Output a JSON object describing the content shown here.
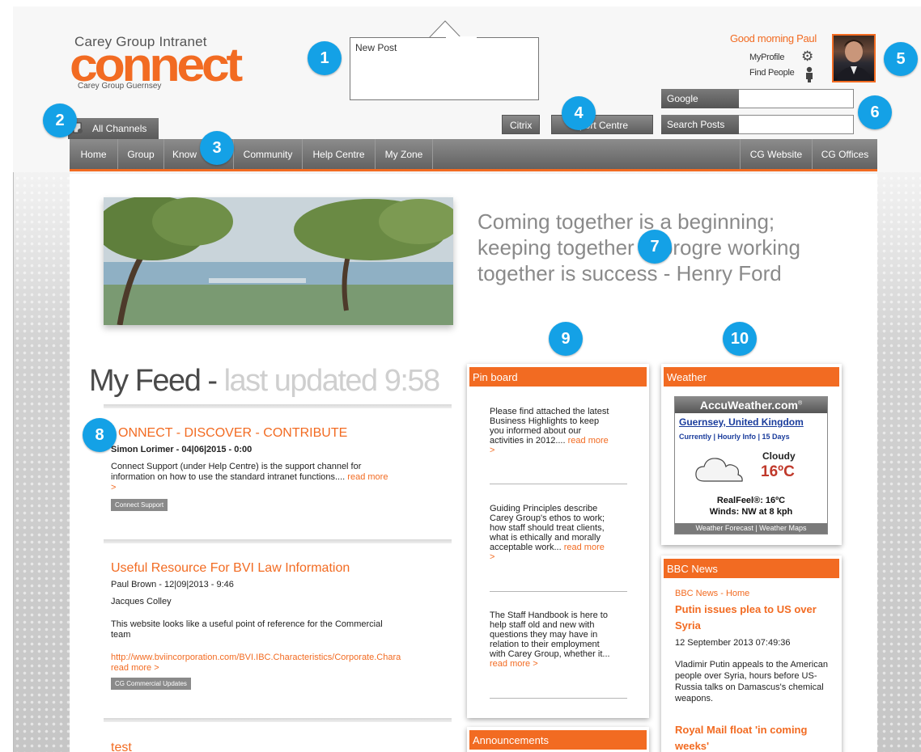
{
  "logo": {
    "top_text": "Carey Group Intranet",
    "wordmark": "connect",
    "sub_text": "Carey Group Guernsey"
  },
  "new_post": {
    "placeholder": "New Post"
  },
  "callouts": [
    "1",
    "2",
    "3",
    "4",
    "5",
    "6",
    "7",
    "8",
    "9",
    "10"
  ],
  "user": {
    "greeting": "Good morning Paul",
    "my_profile": "MyProfile",
    "find_people": "Find People"
  },
  "search": {
    "google_label": "Google",
    "posts_label": "Search Posts"
  },
  "top_buttons": {
    "citrix": "Citrix",
    "support": "port Centre"
  },
  "channels": {
    "label": "All Channels"
  },
  "nav": {
    "items": [
      "Home",
      "Group",
      "Know",
      "Community",
      "Help Centre",
      "My Zone"
    ],
    "right_items": [
      "CG Website",
      "CG Offices"
    ]
  },
  "quote": "Coming together is a beginning; keeping together is progre   working together is success - Henry Ford",
  "feed": {
    "title": "My Feed - ",
    "updated": "last updated 9:58",
    "posts": [
      {
        "title": "ONNECT - DISCOVER - CONTRIBUTE",
        "meta": "Simon Lorimer - 04|06|2015 - 0:00",
        "text": "Connect Support (under Help Centre) is the support channel for information on how to use the standard intranet functions....",
        "more": "read more >",
        "tag": "Connect Support"
      },
      {
        "title": "Useful Resource For BVI Law Information",
        "meta": "Paul Brown - 12|09|2013 - 9:46",
        "author2": "Jacques Colley",
        "text": "This website looks like a useful point of reference for the Commercial team",
        "link": "http://www.bviincorporation.com/BVI.IBC.Characteristics/Corporate.Chara",
        "more": "read more >",
        "tag": "CG Commercial Updates"
      },
      {
        "title": "test"
      }
    ]
  },
  "pinboard": {
    "title": "Pin board",
    "items": [
      {
        "text": "Please find attached the latest Business Highlights to keep you informed about our activities in 2012....",
        "more": "read more >"
      },
      {
        "text": "Guiding Principles describe Carey Group's ethos to work; how staff should treat clients, what is ethically and morally acceptable work...",
        "more": "read more >"
      },
      {
        "text": "The Staff Handbook is here to help staff old and new with questions they may have in relation to their employment with Carey Group, whether it...",
        "more": "read more >"
      }
    ]
  },
  "announcements": {
    "title": "Announcements"
  },
  "weather": {
    "title": "Weather",
    "brand": "AccuWeather.com",
    "brand_sup": "®",
    "location": "Guernsey, United Kingdom",
    "tabs": "Currently | Hourly Info | 15 Days",
    "condition": "Cloudy",
    "temp": "16ºC",
    "realfeel": "RealFeel®: 16ºC",
    "winds": "Winds: NW at 8 kph",
    "footer": "Weather Forecast | Weather Maps"
  },
  "bbc": {
    "title": "BBC News",
    "source": "BBC News - Home",
    "headline": "Putin issues plea to US over Syria",
    "date": "12 September 2013 07:49:36",
    "text": "Vladimir Putin appeals to the American people over Syria, hours before US-Russia talks on Damascus's chemical weapons.",
    "headline2": "Royal Mail float 'in coming weeks'"
  },
  "colors": {
    "accent": "#f26b22",
    "callout": "#14a1e6"
  }
}
